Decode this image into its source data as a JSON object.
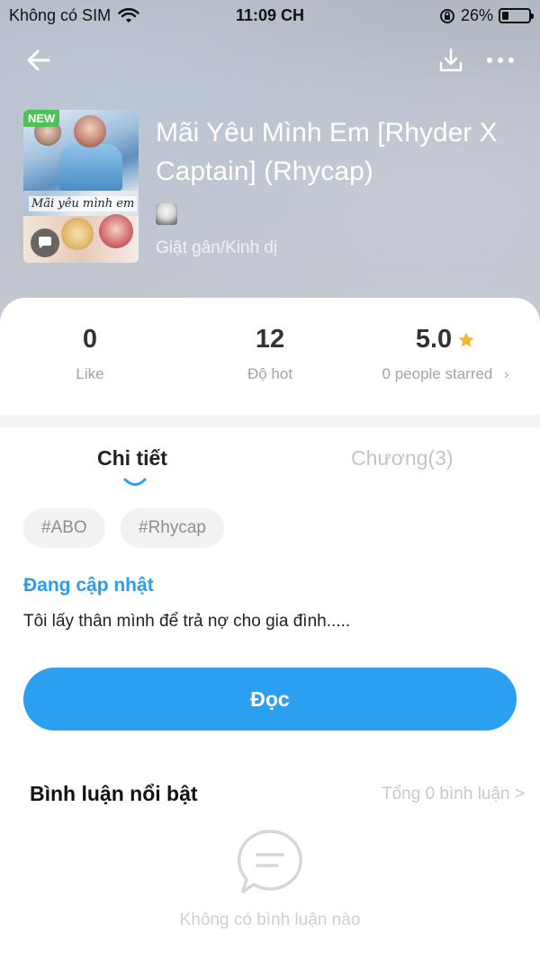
{
  "status_bar": {
    "carrier": "Không có SIM",
    "time": "11:09 CH",
    "battery": "26%",
    "battery_level": 0.26
  },
  "book": {
    "title": "Mãi Yêu Mình Em [Rhyder X Captain] (Rhycap)",
    "genre": "Giật gân/Kinh dị",
    "badge": "NEW",
    "cover_text": "Mãi yêu mình em"
  },
  "stats": {
    "like_value": "0",
    "like_label": "Like",
    "hot_value": "12",
    "hot_label": "Độ hot",
    "rating_value": "5.0",
    "rating_label": "0 people starred",
    "rating_chevron": "›"
  },
  "tabs": {
    "details": "Chi tiết",
    "chapters": "Chương(3)"
  },
  "tags": [
    "#ABO",
    "#Rhycap"
  ],
  "book_status": "Đang cập nhật",
  "summary": "Tôi lấy thân mình để trả nợ cho gia đình.....",
  "read_button": "Đọc",
  "comments": {
    "title": "Bình luận nổi bật",
    "total": "Tổng 0 bình luận >",
    "empty": "Không có bình luận nào"
  },
  "colors": {
    "accent": "#2b9ff0",
    "new_badge": "#4fc15a",
    "star": "#f5b623"
  },
  "icons": [
    "back-arrow-icon",
    "download-icon",
    "more-icon",
    "wifi-icon",
    "lock-rotation-icon",
    "battery-icon",
    "star-icon",
    "chat-bubble-icon"
  ]
}
